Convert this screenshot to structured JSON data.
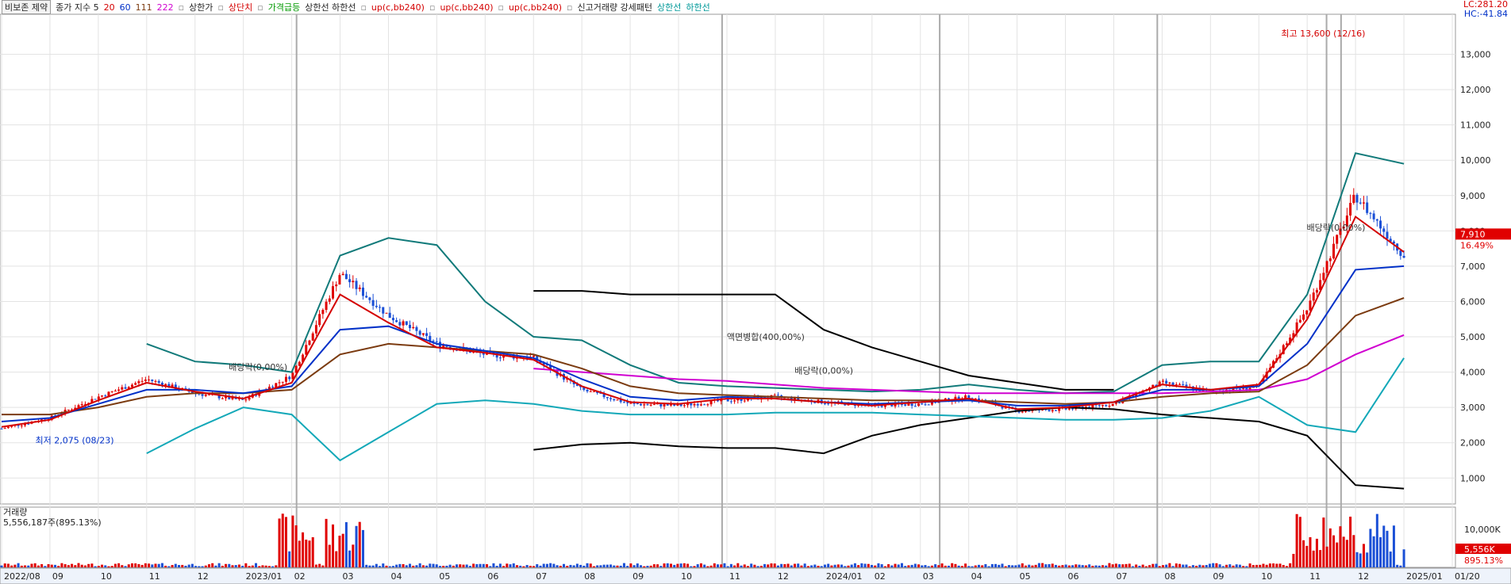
{
  "legend": {
    "stock_name": "비보존 제약",
    "ma_label": "종가 지수 5",
    "ma_periods": [
      {
        "label": "20",
        "color": "#d40000"
      },
      {
        "label": "60",
        "color": "#0030c8"
      },
      {
        "label": "111",
        "color": "#7b3b10"
      },
      {
        "label": "222",
        "color": "#d000d0"
      }
    ],
    "items": [
      {
        "label": "상한가",
        "color": "#222222"
      },
      {
        "label": "상단치",
        "color": "#d40000"
      },
      {
        "label": "가격급등",
        "color": "#009900"
      },
      {
        "label": "상한선 하한선",
        "color": "#222222"
      },
      {
        "label": "up(c,bb240)",
        "color": "#d40000"
      },
      {
        "label": "up(c,bb240)",
        "color": "#d40000"
      },
      {
        "label": "up(c,bb240)",
        "color": "#d40000"
      },
      {
        "label": "신고거래량 강세패턴",
        "color": "#222222"
      },
      {
        "label": "상한선",
        "color": "#009999"
      },
      {
        "label": "하한선",
        "color": "#009999"
      }
    ]
  },
  "lc_value": "LC:281.20",
  "hc_value": "HC:-41.84",
  "volume_title": "거래량",
  "volume_summary": "5,556,187주(895.13%)",
  "chart_data": {
    "type": "candlestick",
    "x_ticks": [
      "2022/08",
      "09",
      "10",
      "11",
      "12",
      "2023/01",
      "02",
      "03",
      "04",
      "05",
      "06",
      "07",
      "08",
      "09",
      "10",
      "11",
      "12",
      "2024/01",
      "02",
      "03",
      "04",
      "05",
      "06",
      "07",
      "08",
      "09",
      "10",
      "11",
      "12",
      "2025/01",
      "01/20"
    ],
    "y_ticks": [
      1000,
      2000,
      3000,
      4000,
      5000,
      6000,
      7000,
      8000,
      9000,
      10000,
      11000,
      12000,
      13000
    ],
    "y_tick_labels": [
      "1,000",
      "2,000",
      "3,000",
      "4,000",
      "5,000",
      "6,000",
      "7,000",
      "8,000",
      "9,000",
      "10,000",
      "11,000",
      "12,000",
      "13,000"
    ],
    "ylim": [
      400,
      14000
    ],
    "price_series": {
      "t": [
        0,
        1,
        2,
        3,
        4,
        5,
        6,
        7,
        8,
        9,
        10,
        11,
        12,
        13,
        14,
        15,
        16,
        17,
        18,
        19,
        20,
        21,
        22,
        23,
        24,
        25,
        26,
        27,
        28,
        29
      ],
      "close": [
        2400,
        2700,
        3300,
        3800,
        3400,
        3200,
        3900,
        6800,
        5600,
        4800,
        4500,
        4400,
        3500,
        3100,
        3050,
        3200,
        3300,
        3150,
        3050,
        3100,
        3300,
        2900,
        2950,
        3100,
        3700,
        3450,
        3600,
        5800,
        9000,
        7300
      ]
    },
    "ma20": [
      2450,
      2650,
      3200,
      3700,
      3450,
      3250,
      3700,
      6200,
      5400,
      4700,
      4550,
      4350,
      3600,
      3150,
      3100,
      3250,
      3250,
      3150,
      3050,
      3150,
      3250,
      2950,
      3000,
      3150,
      3650,
      3500,
      3650,
      5500,
      8400,
      7400
    ],
    "ma60": [
      2600,
      2700,
      3100,
      3500,
      3500,
      3400,
      3600,
      5200,
      5300,
      4800,
      4600,
      4400,
      3800,
      3300,
      3200,
      3300,
      3250,
      3150,
      3100,
      3150,
      3200,
      3050,
      3050,
      3150,
      3500,
      3500,
      3600,
      4800,
      6900,
      7000
    ],
    "ma111": [
      2800,
      2800,
      3000,
      3300,
      3400,
      3400,
      3500,
      4500,
      4800,
      4700,
      4600,
      4500,
      4100,
      3600,
      3400,
      3350,
      3300,
      3250,
      3200,
      3200,
      3200,
      3150,
      3100,
      3150,
      3300,
      3400,
      3450,
      4200,
      5600,
      6100
    ],
    "ma222": [
      null,
      null,
      null,
      null,
      null,
      null,
      null,
      null,
      null,
      null,
      null,
      4100,
      4000,
      3900,
      3800,
      3750,
      3650,
      3550,
      3500,
      3450,
      3400,
      3400,
      3400,
      3400,
      3400,
      3450,
      3500,
      3800,
      4500,
      5050
    ],
    "bb_upper": [
      null,
      null,
      null,
      4800,
      4300,
      4200,
      4000,
      7300,
      7800,
      7600,
      6000,
      5000,
      4900,
      4200,
      3700,
      3600,
      3550,
      3500,
      3450,
      3500,
      3650,
      3500,
      3400,
      3450,
      4200,
      4300,
      4300,
      6200,
      10200,
      9900
    ],
    "bb_lower": [
      null,
      null,
      null,
      1700,
      2400,
      3000,
      2800,
      1500,
      2300,
      3100,
      3200,
      3100,
      2900,
      2800,
      2800,
      2800,
      2850,
      2850,
      2850,
      2800,
      2750,
      2700,
      2650,
      2650,
      2700,
      2900,
      3300,
      2500,
      2300,
      4400
    ],
    "env_upper": [
      null,
      null,
      null,
      null,
      null,
      null,
      null,
      null,
      null,
      null,
      null,
      6300,
      6300,
      6200,
      6200,
      6200,
      6200,
      5200,
      4700,
      4300,
      3900,
      3700,
      3500,
      3500,
      null,
      null,
      null,
      null,
      null,
      null
    ],
    "env_lower": [
      null,
      null,
      null,
      null,
      null,
      null,
      null,
      null,
      null,
      null,
      null,
      1800,
      1950,
      2000,
      1900,
      1850,
      1850,
      1700,
      2200,
      2500,
      2700,
      2900,
      3000,
      2950,
      2800,
      2700,
      2600,
      2200,
      800,
      700
    ],
    "annotations": [
      {
        "text": "최고 13,600 (12/16)",
        "x": 28.3,
        "y": 13600
      },
      {
        "text": "최저 2,075 (08/23)",
        "x": 0.6,
        "y": 2075
      },
      {
        "text": "액면병합(400,00%)",
        "x": 14.9,
        "y": 5000
      },
      {
        "text": "배당락(0,00%)",
        "x": 16.3,
        "y": 4050
      },
      {
        "text": "배당락(0,00%)",
        "x": 4.6,
        "y": 4150
      },
      {
        "text": "배당락(0,00%)",
        "x": 28.3,
        "y": 8100
      }
    ],
    "last_price_label": "7,910",
    "last_change_label": "16.49%",
    "volume": {
      "unit_label": "10,000K",
      "max": 12000,
      "last_label": "5,556K",
      "last_pct_label": "895.13%"
    }
  }
}
